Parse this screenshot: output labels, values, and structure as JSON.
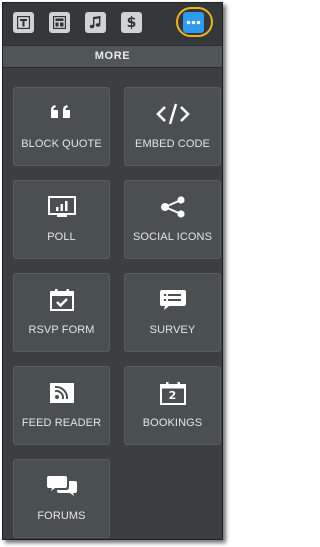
{
  "toolbar": {
    "buttons": [
      {
        "name": "text",
        "icon": "text-icon"
      },
      {
        "name": "layout",
        "icon": "layout-icon"
      },
      {
        "name": "music",
        "icon": "music-note-icon"
      },
      {
        "name": "commerce",
        "icon": "dollar-icon"
      },
      {
        "name": "more",
        "icon": "ellipsis-icon",
        "active": true
      }
    ],
    "dollar_glyph": "$"
  },
  "section": {
    "title": "MORE"
  },
  "tiles": [
    {
      "label": "BLOCK QUOTE",
      "icon": "quote-icon"
    },
    {
      "label": "EMBED CODE",
      "icon": "code-icon"
    },
    {
      "label": "POLL",
      "icon": "bar-chart-icon"
    },
    {
      "label": "SOCIAL ICONS",
      "icon": "share-icon"
    },
    {
      "label": "RSVP FORM",
      "icon": "calendar-check-icon"
    },
    {
      "label": "SURVEY",
      "icon": "list-icon"
    },
    {
      "label": "FEED READER",
      "icon": "rss-icon"
    },
    {
      "label": "BOOKINGS",
      "icon": "calendar-icon",
      "glyph": "2"
    },
    {
      "label": "FORUMS",
      "icon": "chat-bubbles-icon"
    }
  ],
  "colors": {
    "panel": "#3b3f42",
    "tile": "#4a4f52",
    "active_button": "#2d9bf0",
    "highlight_ring": "#f1b31c",
    "text": "#e3e6e8"
  }
}
